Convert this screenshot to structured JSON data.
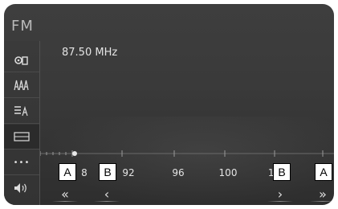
{
  "header": {
    "source": "FM"
  },
  "station": {
    "frequency": "87.50 MHz"
  },
  "sidebar": {
    "items": [
      {
        "icon": "source-select-icon"
      },
      {
        "icon": "presets-icon"
      },
      {
        "icon": "station-list-icon"
      },
      {
        "icon": "manual-tune-icon",
        "selected": true
      },
      {
        "icon": "more-options-icon",
        "label": "•••"
      },
      {
        "icon": "volume-icon"
      }
    ]
  },
  "tuner": {
    "tick_labels": [
      "8",
      "92",
      "96",
      "100",
      "1("
    ]
  },
  "seek_controls": {
    "seek_back": "«",
    "step_back": "‹",
    "step_forward": "›",
    "seek_forward": "»"
  },
  "callouts": {
    "left_outer": "A",
    "left_inner": "B",
    "right_inner": "B",
    "right_outer": "A"
  }
}
